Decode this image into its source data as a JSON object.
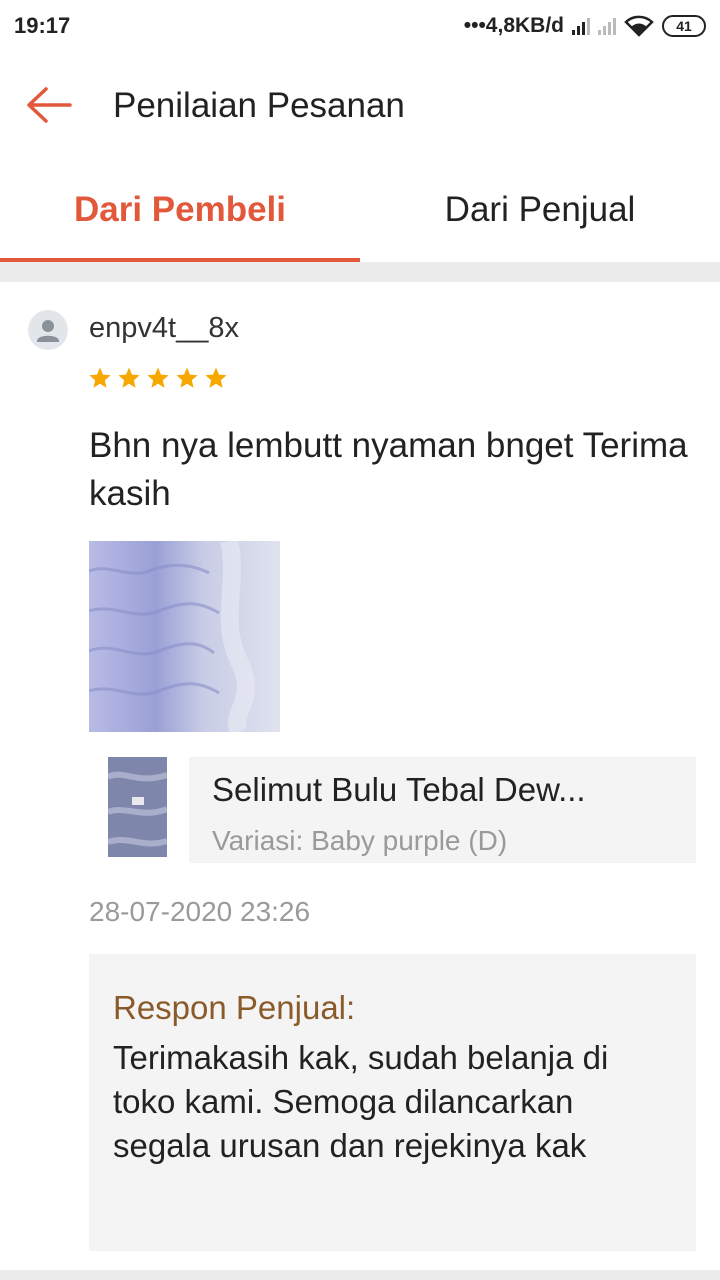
{
  "status_bar": {
    "time": "19:17",
    "net_speed": "•••4,8KB/d",
    "battery": "41"
  },
  "header": {
    "title": "Penilaian Pesanan",
    "back_icon": "arrow-left-icon"
  },
  "tabs": [
    {
      "label": "Dari Pembeli",
      "active": true
    },
    {
      "label": "Dari Penjual",
      "active": false
    }
  ],
  "review": {
    "username": "enpv4t__8x",
    "rating": 5,
    "text": "Bhn nya lembutt nyaman bnget Terima kasih",
    "product": {
      "name": "Selimut Bulu Tebal Dew...",
      "variant": "Variasi: Baby purple (D)"
    },
    "date": "28-07-2020 23:26",
    "seller_response": {
      "label": "Respon Penjual:",
      "text": "Terimakasih kak, sudah belanja di toko kami. Semoga dilancarkan segala urusan dan rejekinya kak"
    }
  },
  "colors": {
    "accent": "#e2583b",
    "star": "#f6a700",
    "response_label": "#8a5a2b"
  }
}
